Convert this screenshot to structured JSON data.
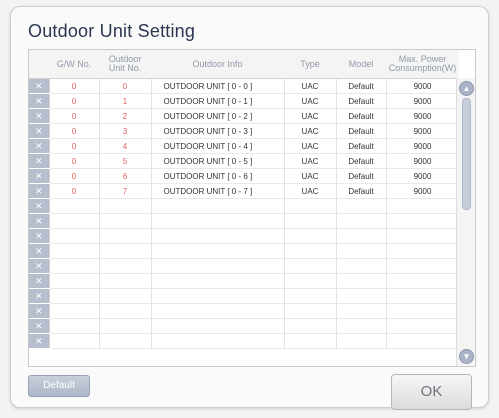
{
  "dialog": {
    "title": "Outdoor Unit Setting"
  },
  "columns": [
    "G/W No.",
    "Outdoor Unit No.",
    "Outdoor Info",
    "Type",
    "Model",
    "Max. Power Consumption(W)"
  ],
  "column_lines": [
    [
      "G/W No."
    ],
    [
      "Outdoor",
      "Unit No."
    ],
    [
      "Outdoor Info"
    ],
    [
      "Type"
    ],
    [
      "Model"
    ],
    [
      "Max. Power",
      "Consumption(W)"
    ]
  ],
  "rows": [
    {
      "gw": "0",
      "unit": "0",
      "info": "OUTDOOR UNIT [ 0 - 0 ]",
      "type": "UAC",
      "model": "Default",
      "power": "9000"
    },
    {
      "gw": "0",
      "unit": "1",
      "info": "OUTDOOR UNIT [ 0 - 1 ]",
      "type": "UAC",
      "model": "Default",
      "power": "9000"
    },
    {
      "gw": "0",
      "unit": "2",
      "info": "OUTDOOR UNIT [ 0 - 2 ]",
      "type": "UAC",
      "model": "Default",
      "power": "9000"
    },
    {
      "gw": "0",
      "unit": "3",
      "info": "OUTDOOR UNIT [ 0 - 3 ]",
      "type": "UAC",
      "model": "Default",
      "power": "9000"
    },
    {
      "gw": "0",
      "unit": "4",
      "info": "OUTDOOR UNIT [ 0 - 4 ]",
      "type": "UAC",
      "model": "Default",
      "power": "9000"
    },
    {
      "gw": "0",
      "unit": "5",
      "info": "OUTDOOR UNIT [ 0 - 5 ]",
      "type": "UAC",
      "model": "Default",
      "power": "9000"
    },
    {
      "gw": "0",
      "unit": "6",
      "info": "OUTDOOR UNIT [ 0 - 6 ]",
      "type": "UAC",
      "model": "Default",
      "power": "9000"
    },
    {
      "gw": "0",
      "unit": "7",
      "info": "OUTDOOR UNIT [ 0 - 7 ]",
      "type": "UAC",
      "model": "Default",
      "power": "9000"
    }
  ],
  "empty_row_count": 10,
  "delete_glyph": "✕",
  "scroll": {
    "up_glyph": "▲",
    "down_glyph": "▼"
  },
  "buttons": {
    "default_label": "Default",
    "ok_label": "OK"
  },
  "colors": {
    "accent_red": "#e06060",
    "delete_cell": "#b7bfce",
    "title": "#2b3550"
  },
  "icons": {
    "delete": "close-icon",
    "scroll_up": "chevron-up-icon",
    "scroll_down": "chevron-down-icon"
  }
}
